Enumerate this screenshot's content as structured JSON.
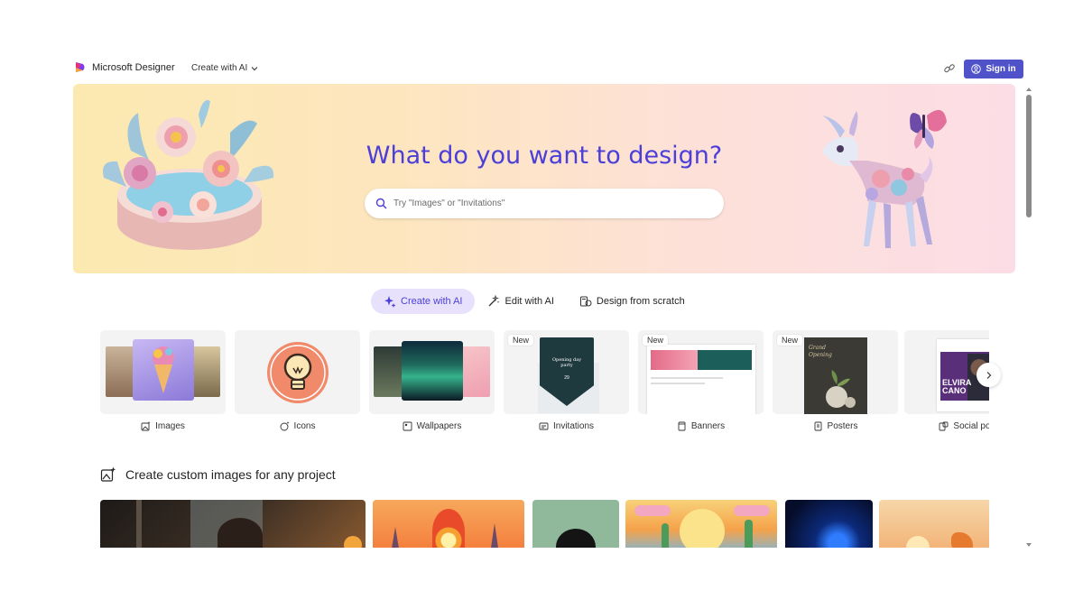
{
  "brand": {
    "name": "Microsoft Designer"
  },
  "nav": {
    "create_menu": "Create with AI",
    "sign_in": "Sign in"
  },
  "hero": {
    "title": "What do you want to design?",
    "search_placeholder": "Try \"Images\" or \"Invitations\""
  },
  "modes": [
    {
      "label": "Create with AI",
      "icon": "sparkle-icon",
      "active": true
    },
    {
      "label": "Edit with AI",
      "icon": "magic-wand-icon",
      "active": false
    },
    {
      "label": "Design from scratch",
      "icon": "design-icon",
      "active": false
    }
  ],
  "categories": [
    {
      "label": "Images",
      "icon": "image-sparkle-icon",
      "badge": ""
    },
    {
      "label": "Icons",
      "icon": "icon-sparkle-icon",
      "badge": ""
    },
    {
      "label": "Wallpapers",
      "icon": "wallpaper-icon",
      "badge": ""
    },
    {
      "label": "Invitations",
      "icon": "invitation-icon",
      "badge": "New"
    },
    {
      "label": "Banners",
      "icon": "banner-icon",
      "badge": "New"
    },
    {
      "label": "Posters",
      "icon": "poster-icon",
      "badge": "New"
    },
    {
      "label": "Social pos",
      "icon": "social-post-icon",
      "badge": ""
    }
  ],
  "invitation_card": {
    "title": "Opening day party",
    "date": "29"
  },
  "poster_card": {
    "title": "Grand Opening"
  },
  "social_card": {
    "name": "ELVIRA CANO"
  },
  "section": {
    "title": "Create custom images for any project"
  },
  "colors": {
    "accent": "#4f52c8",
    "hero_title": "#4b3fd8",
    "active_tab_bg": "#e8e1fb"
  }
}
